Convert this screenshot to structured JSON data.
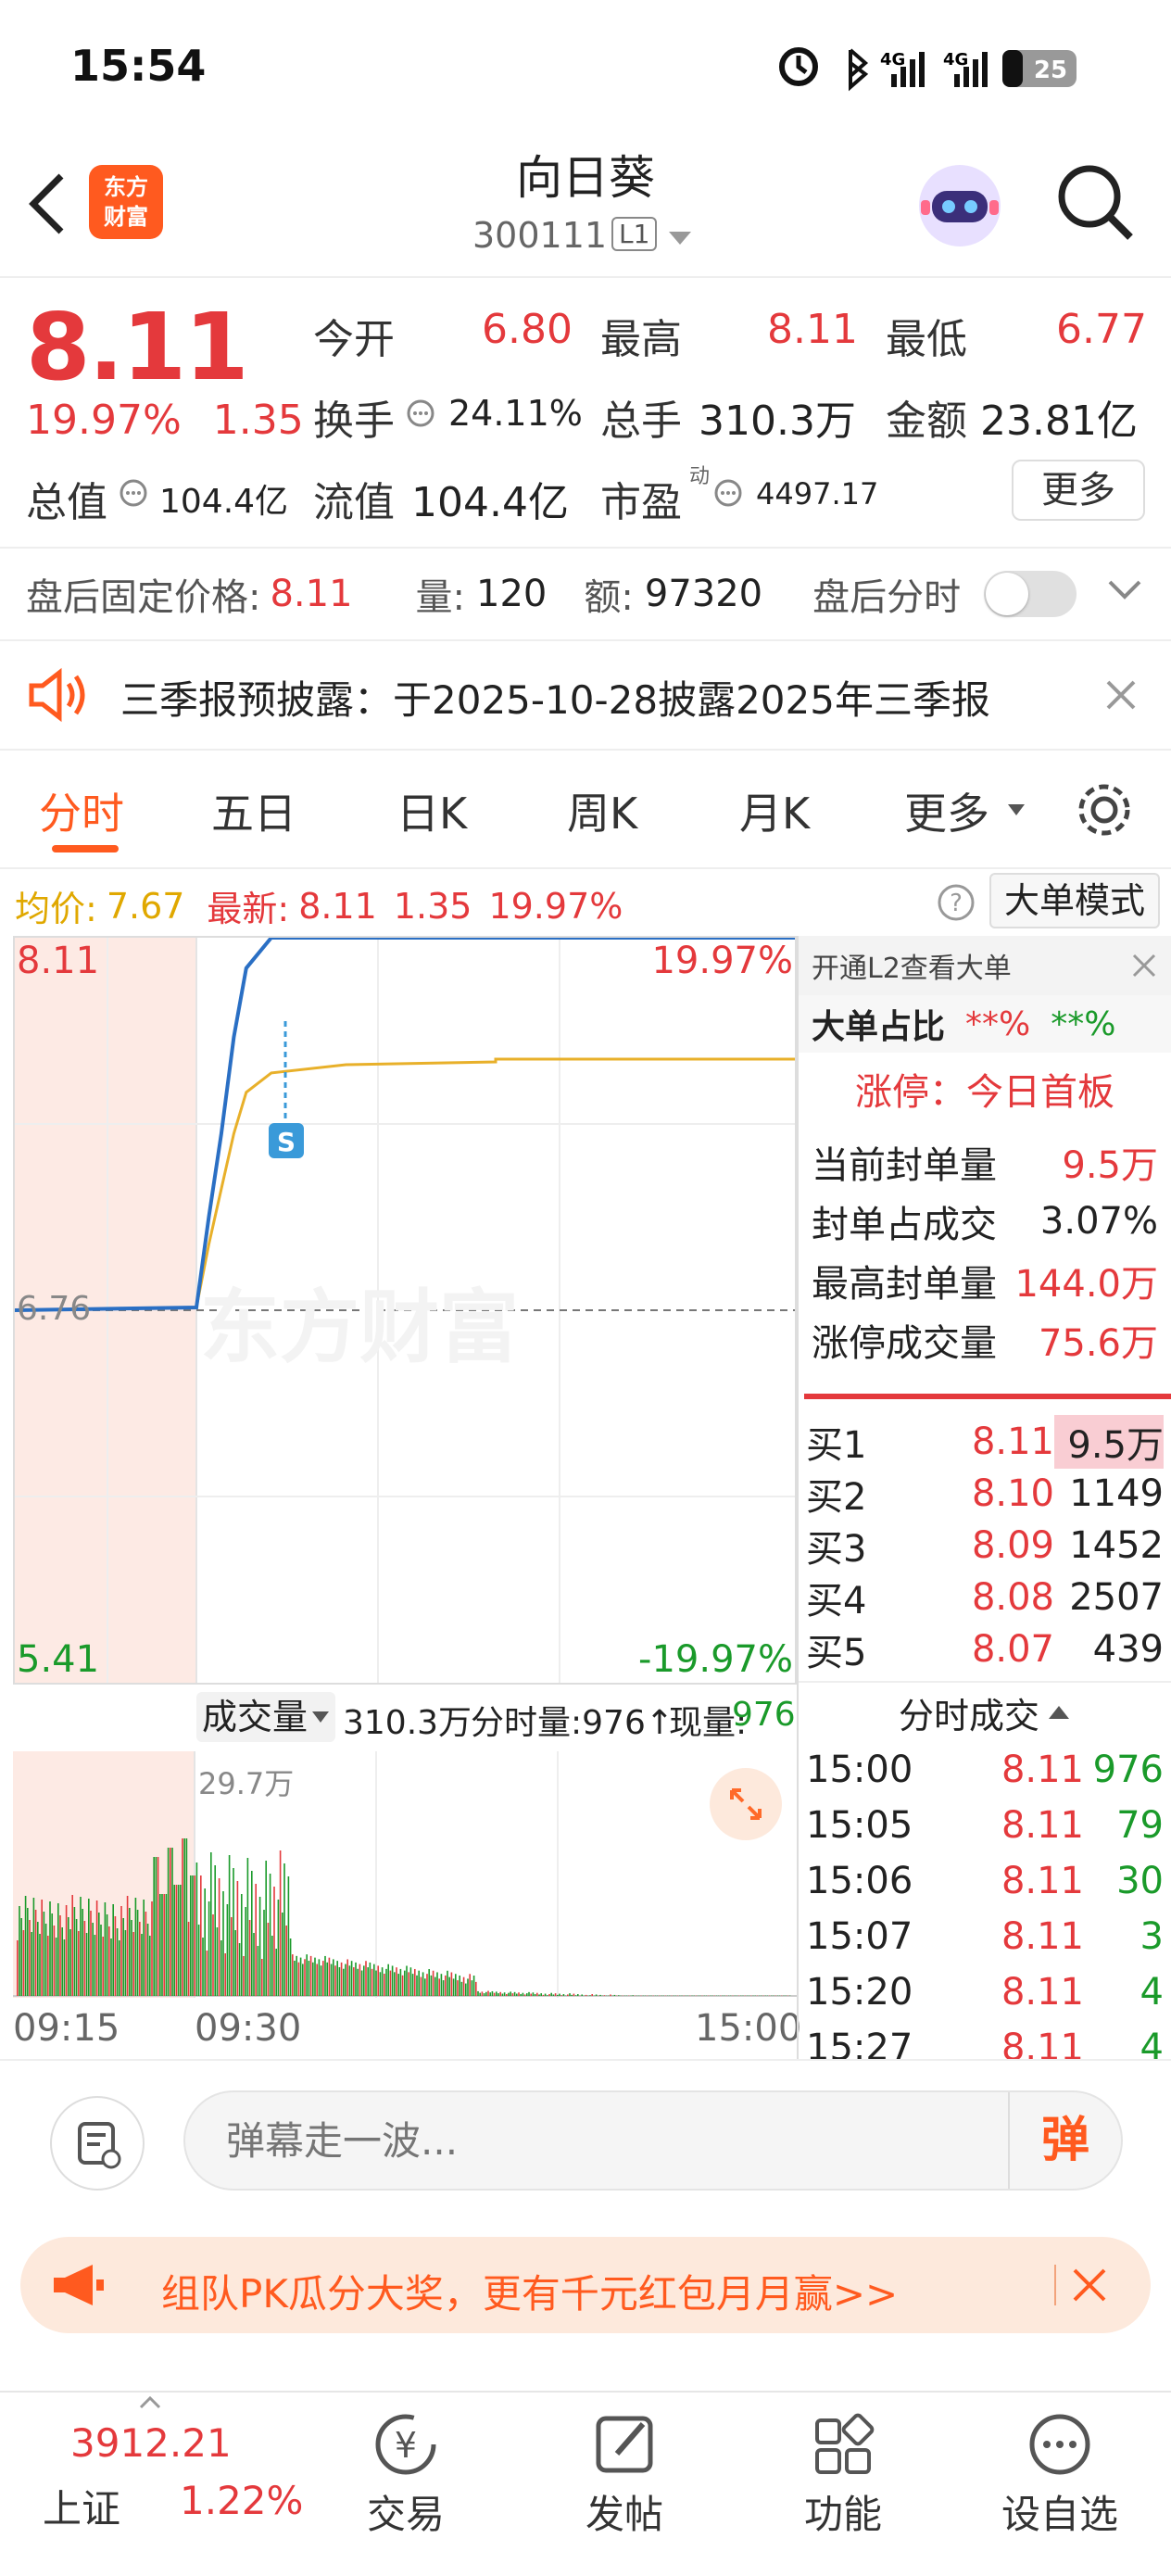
{
  "status_bar": {
    "time": "15:54",
    "battery": "25"
  },
  "header": {
    "title": "向日葵",
    "code": "300111",
    "level": "L1"
  },
  "quote": {
    "price": "8.11",
    "change_pct": "19.97%",
    "change": "1.35",
    "open_label": "今开",
    "open": "6.80",
    "high_label": "最高",
    "high": "8.11",
    "low_label": "最低",
    "low": "6.77",
    "turnover_label": "换手",
    "turnover": "24.11%",
    "volume_label": "总手",
    "volume": "310.3万",
    "amount_label": "金额",
    "amount": "23.81亿",
    "mktcap_label": "总值",
    "mktcap": "104.4亿",
    "float_label": "流值",
    "float": "104.4亿",
    "pe_label": "市盈",
    "pe_sup": "动",
    "pe": "4497.17",
    "more_label": "更多"
  },
  "after_hours": {
    "price_label": "盘后固定价格:",
    "price": "8.11",
    "vol_label": "量:",
    "vol": "120",
    "amt_label": "额:",
    "amt": "97320",
    "toggle_label": "盘后分时"
  },
  "notice": {
    "text": "三季报预披露：于2025-10-28披露2025年三季报"
  },
  "tabs": [
    "分时",
    "五日",
    "日K",
    "周K",
    "月K",
    "更多"
  ],
  "chart_header": {
    "avg_label": "均价:",
    "avg": "7.67",
    "latest_label": "最新:",
    "latest": "8.11",
    "chg": "1.35",
    "pct": "19.97%",
    "mode_btn": "大单模式"
  },
  "chart": {
    "top_price": "8.11",
    "top_pct": "19.97%",
    "bottom_price": "5.41",
    "bottom_pct": "-19.97%",
    "mid_price": "6.76",
    "watermark": "东方财富",
    "s_marker": "S",
    "vol_select": "成交量",
    "vol_total": "310.3万",
    "tick_vol_label": "分时量:976↑",
    "cur_vol_label": "现量:",
    "cur_vol": "976",
    "vol_max": "29.7万",
    "times": [
      "09:15",
      "09:30",
      "15:00"
    ]
  },
  "chart_data": {
    "type": "line",
    "title": "",
    "ylim": [
      5.41,
      8.11
    ],
    "x": [
      "09:15",
      "09:30",
      "09:35",
      "09:40",
      "09:45",
      "09:50",
      "10:00",
      "10:30",
      "11:30",
      "13:00",
      "15:00"
    ],
    "series": [
      {
        "values": [
          6.76,
          6.77,
          7.1,
          7.4,
          7.75,
          8.0,
          8.11,
          8.11,
          8.11,
          8.11,
          8.11
        ]
      },
      {
        "values": [
          6.76,
          6.77,
          7.0,
          7.2,
          7.4,
          7.55,
          7.62,
          7.65,
          7.66,
          7.67,
          7.67
        ]
      }
    ]
  },
  "right_panel": {
    "l2_link": "开通L2查看大单",
    "big_ratio_label": "大单占比",
    "big_ratio_red": "**%",
    "big_ratio_green": "**%",
    "limit_title": "涨停：今日首板",
    "stats": [
      {
        "label": "当前封单量",
        "value": "9.5万"
      },
      {
        "label": "封单占成交",
        "value": "3.07%"
      },
      {
        "label": "最高封单量",
        "value": "144.0万"
      },
      {
        "label": "涨停成交量",
        "value": "75.6万"
      }
    ],
    "book": [
      {
        "label": "买1",
        "price": "8.11",
        "vol": "9.5万"
      },
      {
        "label": "买2",
        "price": "8.10",
        "vol": "1149"
      },
      {
        "label": "买3",
        "price": "8.09",
        "vol": "1452"
      },
      {
        "label": "买4",
        "price": "8.08",
        "vol": "2507"
      },
      {
        "label": "买5",
        "price": "8.07",
        "vol": "439"
      }
    ],
    "trades_title": "分时成交",
    "trades": [
      {
        "time": "15:00",
        "price": "8.11",
        "vol": "976"
      },
      {
        "time": "15:05",
        "price": "8.11",
        "vol": "79"
      },
      {
        "time": "15:06",
        "price": "8.11",
        "vol": "30"
      },
      {
        "time": "15:07",
        "price": "8.11",
        "vol": "3"
      },
      {
        "time": "15:20",
        "price": "8.11",
        "vol": "4"
      },
      {
        "time": "15:27",
        "price": "8.11",
        "vol": "4"
      }
    ]
  },
  "danmu": {
    "placeholder": "弹幕走一波...",
    "btn": "弹"
  },
  "promo": {
    "text": "组队PK瓜分大奖，更有千元红包月月赢>>"
  },
  "bottom_nav": {
    "index_value": "3912.21",
    "index_name": "上证",
    "index_pct": "1.22%",
    "items": [
      "交易",
      "发帖",
      "功能",
      "设自选"
    ]
  }
}
